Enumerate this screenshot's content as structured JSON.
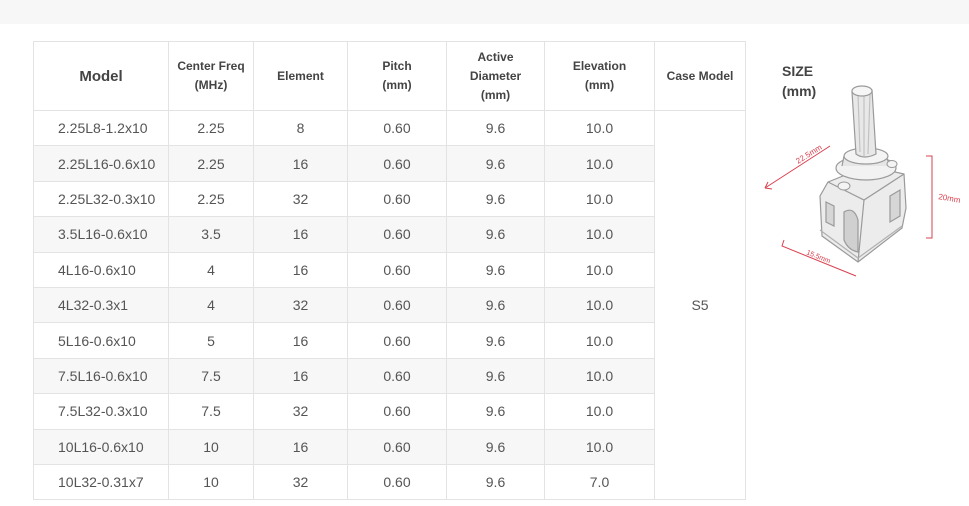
{
  "table": {
    "headers": {
      "model": "Model",
      "center_freq": [
        "Center Freq",
        "(MHz)"
      ],
      "element": "Element",
      "pitch": [
        "Pitch",
        "(mm)"
      ],
      "active_diameter": [
        "Active",
        "Diameter",
        "(mm)"
      ],
      "elevation": [
        "Elevation",
        "(mm)"
      ],
      "case_model": "Case Model"
    },
    "rows": [
      [
        "2.25L8-1.2x10",
        "2.25",
        "8",
        "0.60",
        "9.6",
        "10.0"
      ],
      [
        "2.25L16-0.6x10",
        "2.25",
        "16",
        "0.60",
        "9.6",
        "10.0"
      ],
      [
        "2.25L32-0.3x10",
        "2.25",
        "32",
        "0.60",
        "9.6",
        "10.0"
      ],
      [
        "3.5L16-0.6x10",
        "3.5",
        "16",
        "0.60",
        "9.6",
        "10.0"
      ],
      [
        "4L16-0.6x10",
        "4",
        "16",
        "0.60",
        "9.6",
        "10.0"
      ],
      [
        "4L32-0.3x1",
        "4",
        "32",
        "0.60",
        "9.6",
        "10.0"
      ],
      [
        "5L16-0.6x10",
        "5",
        "16",
        "0.60",
        "9.6",
        "10.0"
      ],
      [
        "7.5L16-0.6x10",
        "7.5",
        "16",
        "0.60",
        "9.6",
        "10.0"
      ],
      [
        "7.5L32-0.3x10",
        "7.5",
        "32",
        "0.60",
        "9.6",
        "10.0"
      ],
      [
        "10L16-0.6x10",
        "10",
        "16",
        "0.60",
        "9.6",
        "10.0"
      ],
      [
        "10L32-0.31x7",
        "10",
        "32",
        "0.60",
        "9.6",
        "7.0"
      ]
    ],
    "case_model_value": "S5"
  },
  "size": {
    "title": [
      "SIZE",
      "(mm)"
    ],
    "dimensions": {
      "length": "22.5mm",
      "height": "20mm",
      "width": "15.5mm"
    },
    "dimension_color": "#d9404f"
  }
}
